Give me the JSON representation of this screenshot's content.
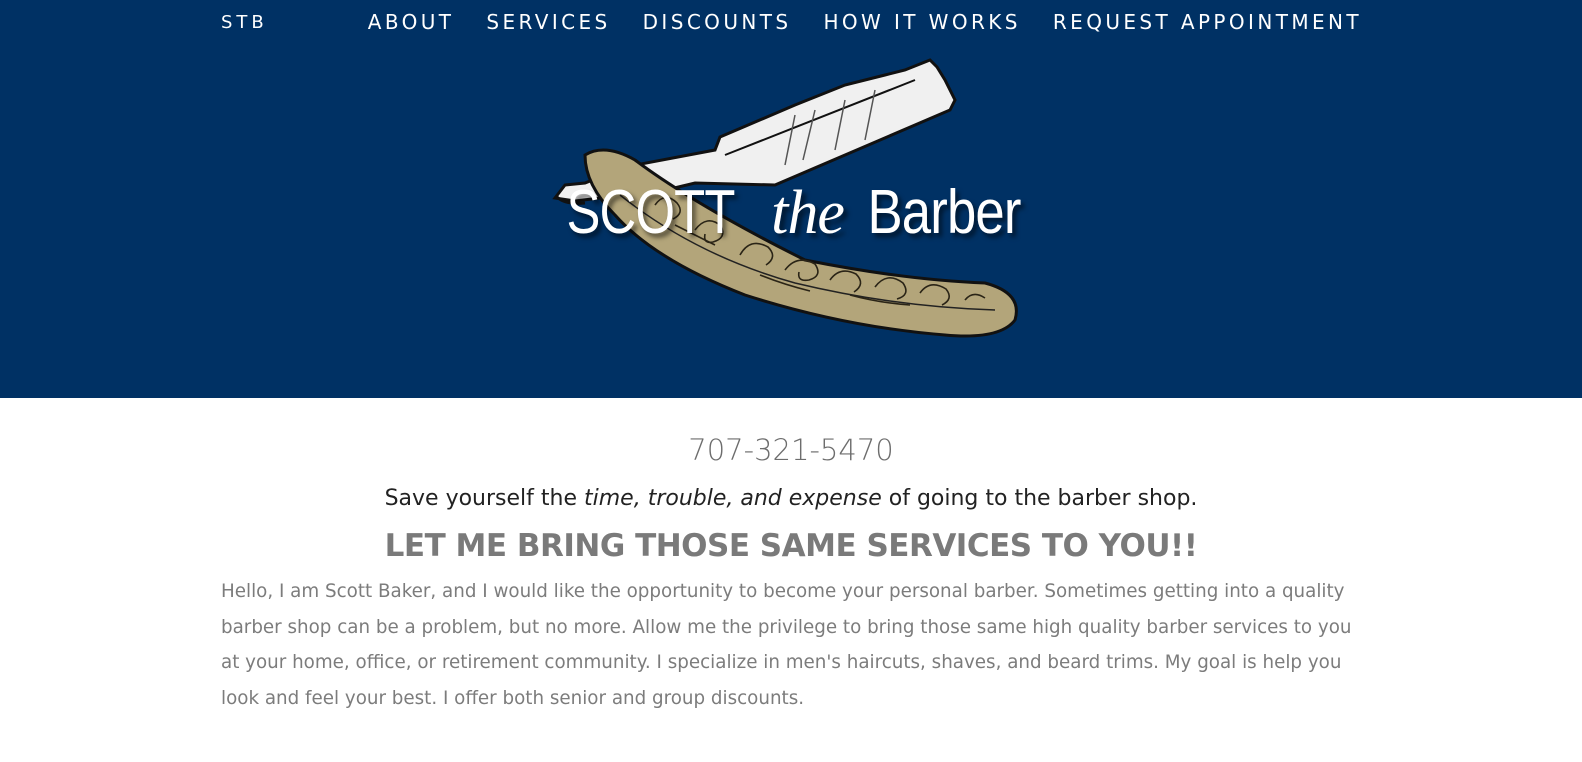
{
  "nav": {
    "brand": "STB",
    "links": [
      "ABOUT",
      "SERVICES",
      "DISCOUNTS",
      "HOW IT WORKS",
      "REQUEST APPOINTMENT"
    ]
  },
  "logo": {
    "word1": "SCOTT",
    "word2": "the",
    "word3": "Barber"
  },
  "content": {
    "phone": "707-321-5470",
    "tagline_before": "Save yourself the ",
    "tagline_emphasis": "time, trouble, and expense",
    "tagline_after": " of going to the barber shop.",
    "headline": "LET ME BRING THOSE SAME SERVICES TO YOU!!",
    "intro": "Hello, I am Scott Baker, and I would like the opportunity to become your personal barber. Sometimes getting into a quality barber shop can be a problem, but no more. Allow me the privilege to bring those same high quality barber services to you at your home, office, or retirement community. I specialize in men's haircuts, shaves, and beard trims. My goal is help you look and feel your best. I offer both senior and group discounts."
  },
  "colors": {
    "hero_background": "#003164",
    "razor_handle": "#b3a57a",
    "razor_blade": "#f0f0f0"
  }
}
